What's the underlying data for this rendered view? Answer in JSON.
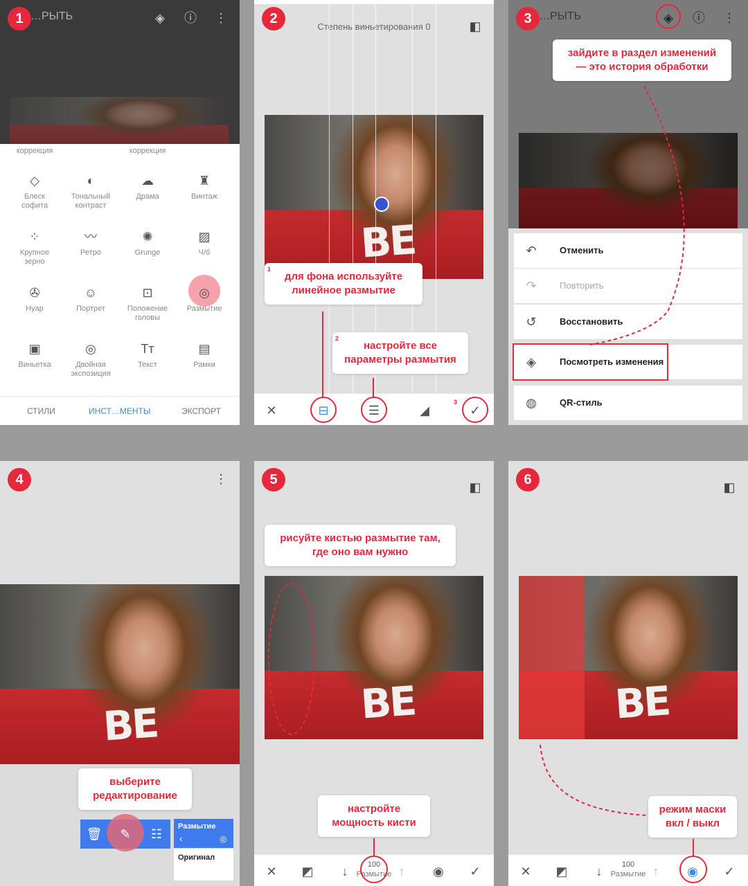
{
  "steps": [
    "1",
    "2",
    "3",
    "4",
    "5",
    "6"
  ],
  "panel1": {
    "open_label": "…РЫТЬ",
    "partial_labels": [
      "коррекция",
      "коррекция"
    ],
    "tools": [
      {
        "label": "Блеск\nсофита",
        "icon": "sparkle-diamond-icon",
        "glyph": "◇"
      },
      {
        "label": "Тональный\nконтраст",
        "icon": "tonal-contrast-icon",
        "glyph": "◐"
      },
      {
        "label": "Драма",
        "icon": "cloud-drama-icon",
        "glyph": "☁"
      },
      {
        "label": "Винтаж",
        "icon": "lamp-vintage-icon",
        "glyph": "♜"
      },
      {
        "label": "Крупное\nзерно",
        "icon": "grain-icon",
        "glyph": "⁘"
      },
      {
        "label": "Ретро",
        "icon": "mustache-retro-icon",
        "glyph": "〰"
      },
      {
        "label": "Grunge",
        "icon": "grunge-icon",
        "glyph": "✺"
      },
      {
        "label": "Ч/б",
        "icon": "bw-icon",
        "glyph": "▨"
      },
      {
        "label": "Нуар",
        "icon": "film-reel-icon",
        "glyph": "✇"
      },
      {
        "label": "Портрет",
        "icon": "portrait-face-icon",
        "glyph": "☺"
      },
      {
        "label": "Положение\nголовы",
        "icon": "head-pose-icon",
        "glyph": "⊡"
      },
      {
        "label": "Размытие",
        "icon": "blur-icon",
        "glyph": "◎"
      },
      {
        "label": "Виньетка",
        "icon": "vignette-icon",
        "glyph": "▣"
      },
      {
        "label": "Двойная\nэкспозиция",
        "icon": "double-exposure-icon",
        "glyph": "◎"
      },
      {
        "label": "Текст",
        "icon": "text-icon",
        "glyph": "Tт"
      },
      {
        "label": "Рамки",
        "icon": "frame-icon",
        "glyph": "▤"
      }
    ],
    "tabs": [
      "СТИЛИ",
      "ИНСТ…МЕНТЫ",
      "ЭКСПОРТ"
    ]
  },
  "panel2": {
    "title": "Степень виньетирования 0",
    "callout1": "для фона используйте\nлинейное размытие",
    "callout2": "настройте все\nпараметры размытия",
    "num1": "1",
    "num2": "2",
    "num3": "3"
  },
  "panel3": {
    "open_label": "…РЫТЬ",
    "callout": "зайдите в раздел изменений\n— это история обработки",
    "menu": [
      {
        "label": "Отменить",
        "icon": "undo-icon",
        "glyph": "↶"
      },
      {
        "label": "Повторить",
        "icon": "redo-icon",
        "glyph": "↷"
      },
      {
        "label": "Восстановить",
        "icon": "restore-icon",
        "glyph": "↺"
      },
      {
        "label": "Посмотреть изменения",
        "icon": "layers-icon",
        "glyph": "◈"
      },
      {
        "label": "QR-стиль",
        "icon": "qr-style-icon",
        "glyph": "◍"
      }
    ]
  },
  "panel4": {
    "callout": "выберите\nредактирование",
    "blur_label": "Размытие",
    "blur_back": "‹",
    "original_label": "Оригинал"
  },
  "panel5": {
    "callout_top": "рисуйте кистью размытие там,\nгде оно вам нужно",
    "callout_bottom": "настройте\nмощность кисти",
    "strength_value": "100",
    "strength_label": "Размытие"
  },
  "panel6": {
    "callout": "режим маски\nвкл / выкл",
    "strength_value": "100",
    "strength_label": "Размытие"
  },
  "colors": {
    "accent": "#e5283b",
    "blue": "#3f7bee",
    "tab_active": "#3a8ee6"
  }
}
